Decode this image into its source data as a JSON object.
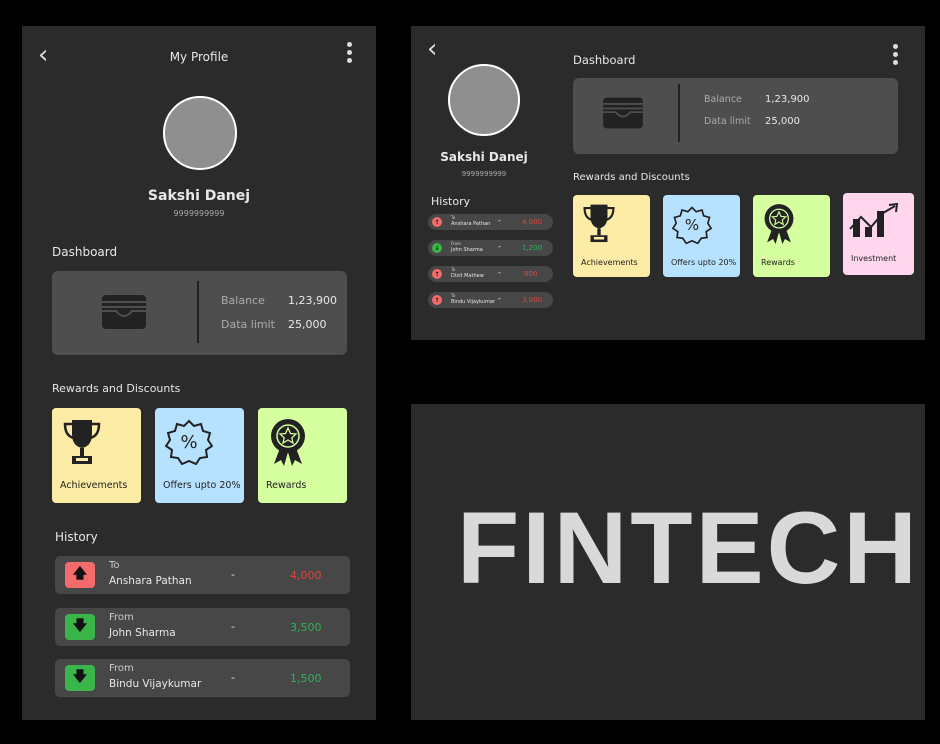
{
  "colors": {
    "achievements": "#fdeca6",
    "offers": "#b7e2ff",
    "rewards": "#d6ff9f",
    "investment": "#ffd6ee",
    "negative": "#e0443f",
    "positive": "#2fb35a"
  },
  "mobile": {
    "title": "My Profile",
    "back_icon": "chevron-left-icon",
    "menu_icon": "kebab-menu-icon",
    "name": "Sakshi Danej",
    "phone": "9999999999",
    "dashboard_label": "Dashboard",
    "balance_label": "Balance",
    "balance_value": "1,23,900",
    "data_label": "Data limit",
    "data_value": "25,000",
    "rewards_label": "Rewards and Discounts",
    "tiles": [
      "Achievements",
      "Offers upto 20%",
      "Rewards"
    ],
    "history_label": "History",
    "history": [
      {
        "direction": "To",
        "name": "Anshara Pathan",
        "dash": "-",
        "amount": "4,000",
        "type": "debit"
      },
      {
        "direction": "From",
        "name": "John Sharma",
        "dash": "-",
        "amount": "3,500",
        "type": "credit"
      },
      {
        "direction": "From",
        "name": "Bindu Vijaykumar",
        "dash": "-",
        "amount": "1,500",
        "type": "credit"
      }
    ]
  },
  "tablet": {
    "name": "Sakshi Danej",
    "phone": "9999999999",
    "history_label": "History",
    "history": [
      {
        "direction": "To",
        "name": "Anshara Pathan",
        "dash": "-",
        "amount": "4,000",
        "type": "debit"
      },
      {
        "direction": "From",
        "name": "John Sharma",
        "dash": "-",
        "amount": "1,200",
        "type": "credit"
      },
      {
        "direction": "To",
        "name": "Dixit Mathew",
        "dash": "-",
        "amount": "800",
        "type": "debit"
      },
      {
        "direction": "To",
        "name": "Bindu Vijaykumar",
        "dash": "-",
        "amount": "3,000",
        "type": "debit"
      }
    ],
    "dashboard_label": "Dashboard",
    "balance_label": "Balance",
    "balance_value": "1,23,900",
    "data_label": "Data limit",
    "data_value": "25,000",
    "rewards_label": "Rewards and Discounts",
    "tiles": [
      "Achievements",
      "Offers upto 20%",
      "Rewards",
      "Investment"
    ]
  },
  "banner": {
    "text": "FINTECH"
  }
}
